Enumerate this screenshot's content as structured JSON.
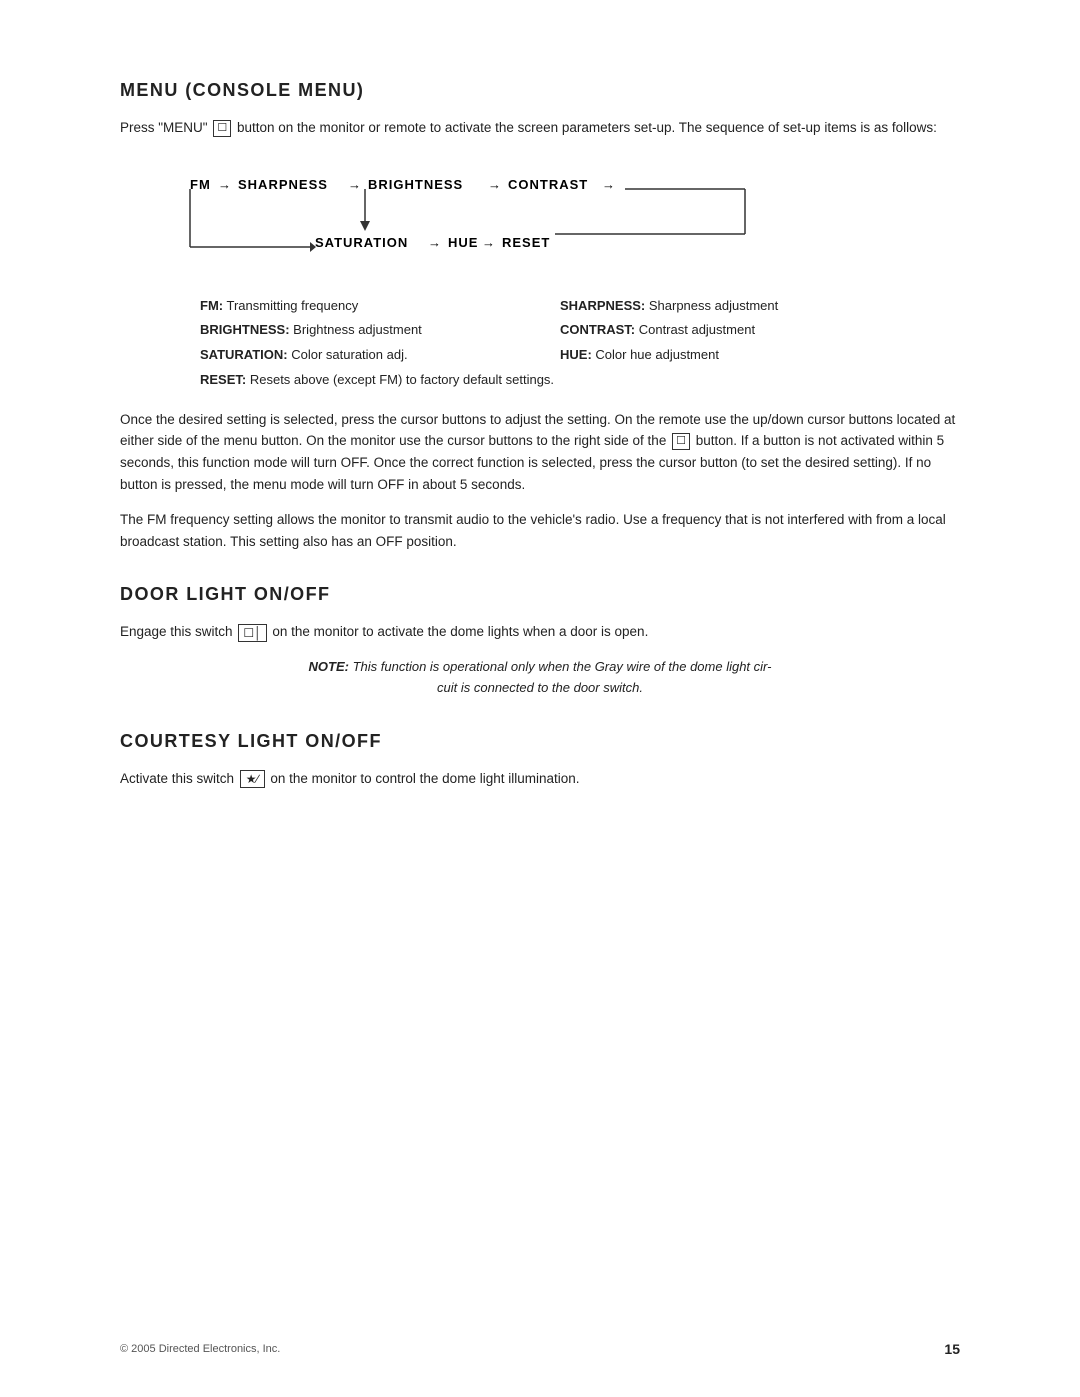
{
  "page": {
    "sections": [
      {
        "id": "menu-console",
        "heading": "Menu (Console Menu)",
        "paragraphs": [
          {
            "id": "menu-para-1",
            "text_before_icon": "Press \"MENU\" ",
            "icon": "menu-icon",
            "text_after_icon": " button on the monitor or remote to activate the screen parameters set-up. The sequence of set-up items is as follows:"
          },
          {
            "id": "menu-para-2",
            "text": "Once the desired setting is selected, press the cursor buttons to adjust the setting. On the remote use the up/down cursor buttons located at either side of the menu button. On the monitor use the cursor buttons to the right side of the ",
            "text_after_icon": " button. If a button is not activated within 5 seconds, this function mode will turn OFF. Once the correct function is selected, press the cursor button (to set the desired setting). If no button is pressed, the menu mode will turn OFF in about 5 seconds."
          },
          {
            "id": "menu-para-3",
            "text": "The FM frequency setting allows the monitor to transmit audio to the vehicle’s radio. Use a frequency that is not interfered with from a local broadcast station. This setting also has an OFF position."
          }
        ],
        "flow": {
          "row1": [
            "FM",
            "→",
            "Sharpness",
            "→",
            "Brightness",
            "→",
            "Contrast",
            "→"
          ],
          "row2": [
            "Saturation",
            "→",
            "Hue",
            "→",
            "Reset"
          ]
        },
        "definitions": [
          {
            "label": "FM:",
            "desc": "Transmitting frequency"
          },
          {
            "label": "SHARPNESS:",
            "desc": "Sharpness adjustment"
          },
          {
            "label": "BRIGHTNESS:",
            "desc": "Brightness adjustment"
          },
          {
            "label": "CONTRAST:",
            "desc": "Contrast adjustment"
          },
          {
            "label": "SATURATION:",
            "desc": "Color saturation adj."
          },
          {
            "label": "HUE:",
            "desc": "Color hue adjustment"
          },
          {
            "label": "RESET:",
            "desc": "Resets above (except FM) to factory default settings.",
            "full_row": true
          }
        ]
      },
      {
        "id": "door-light",
        "heading": "Door Light On/Off",
        "paragraphs": [
          {
            "id": "door-para-1",
            "text_before_icon": "Engage this switch ",
            "icon": "door-icon",
            "text_after_icon": " on the monitor to activate the dome lights when a door is open."
          }
        ],
        "note": {
          "bold_label": "NOTE:",
          "text": " This function is operational only when the Gray wire of the dome light circuit is connected to the door switch."
        }
      },
      {
        "id": "courtesy-light",
        "heading": "Courtesy Light On/Off",
        "paragraphs": [
          {
            "id": "courtesy-para-1",
            "text_before_icon": "Activate this switch ",
            "icon": "light-icon",
            "text_after_icon": " on the monitor to control the dome light illumination."
          }
        ]
      }
    ],
    "footer": {
      "copyright": "© 2005 Directed Electronics, Inc.",
      "page_number": "15"
    }
  }
}
